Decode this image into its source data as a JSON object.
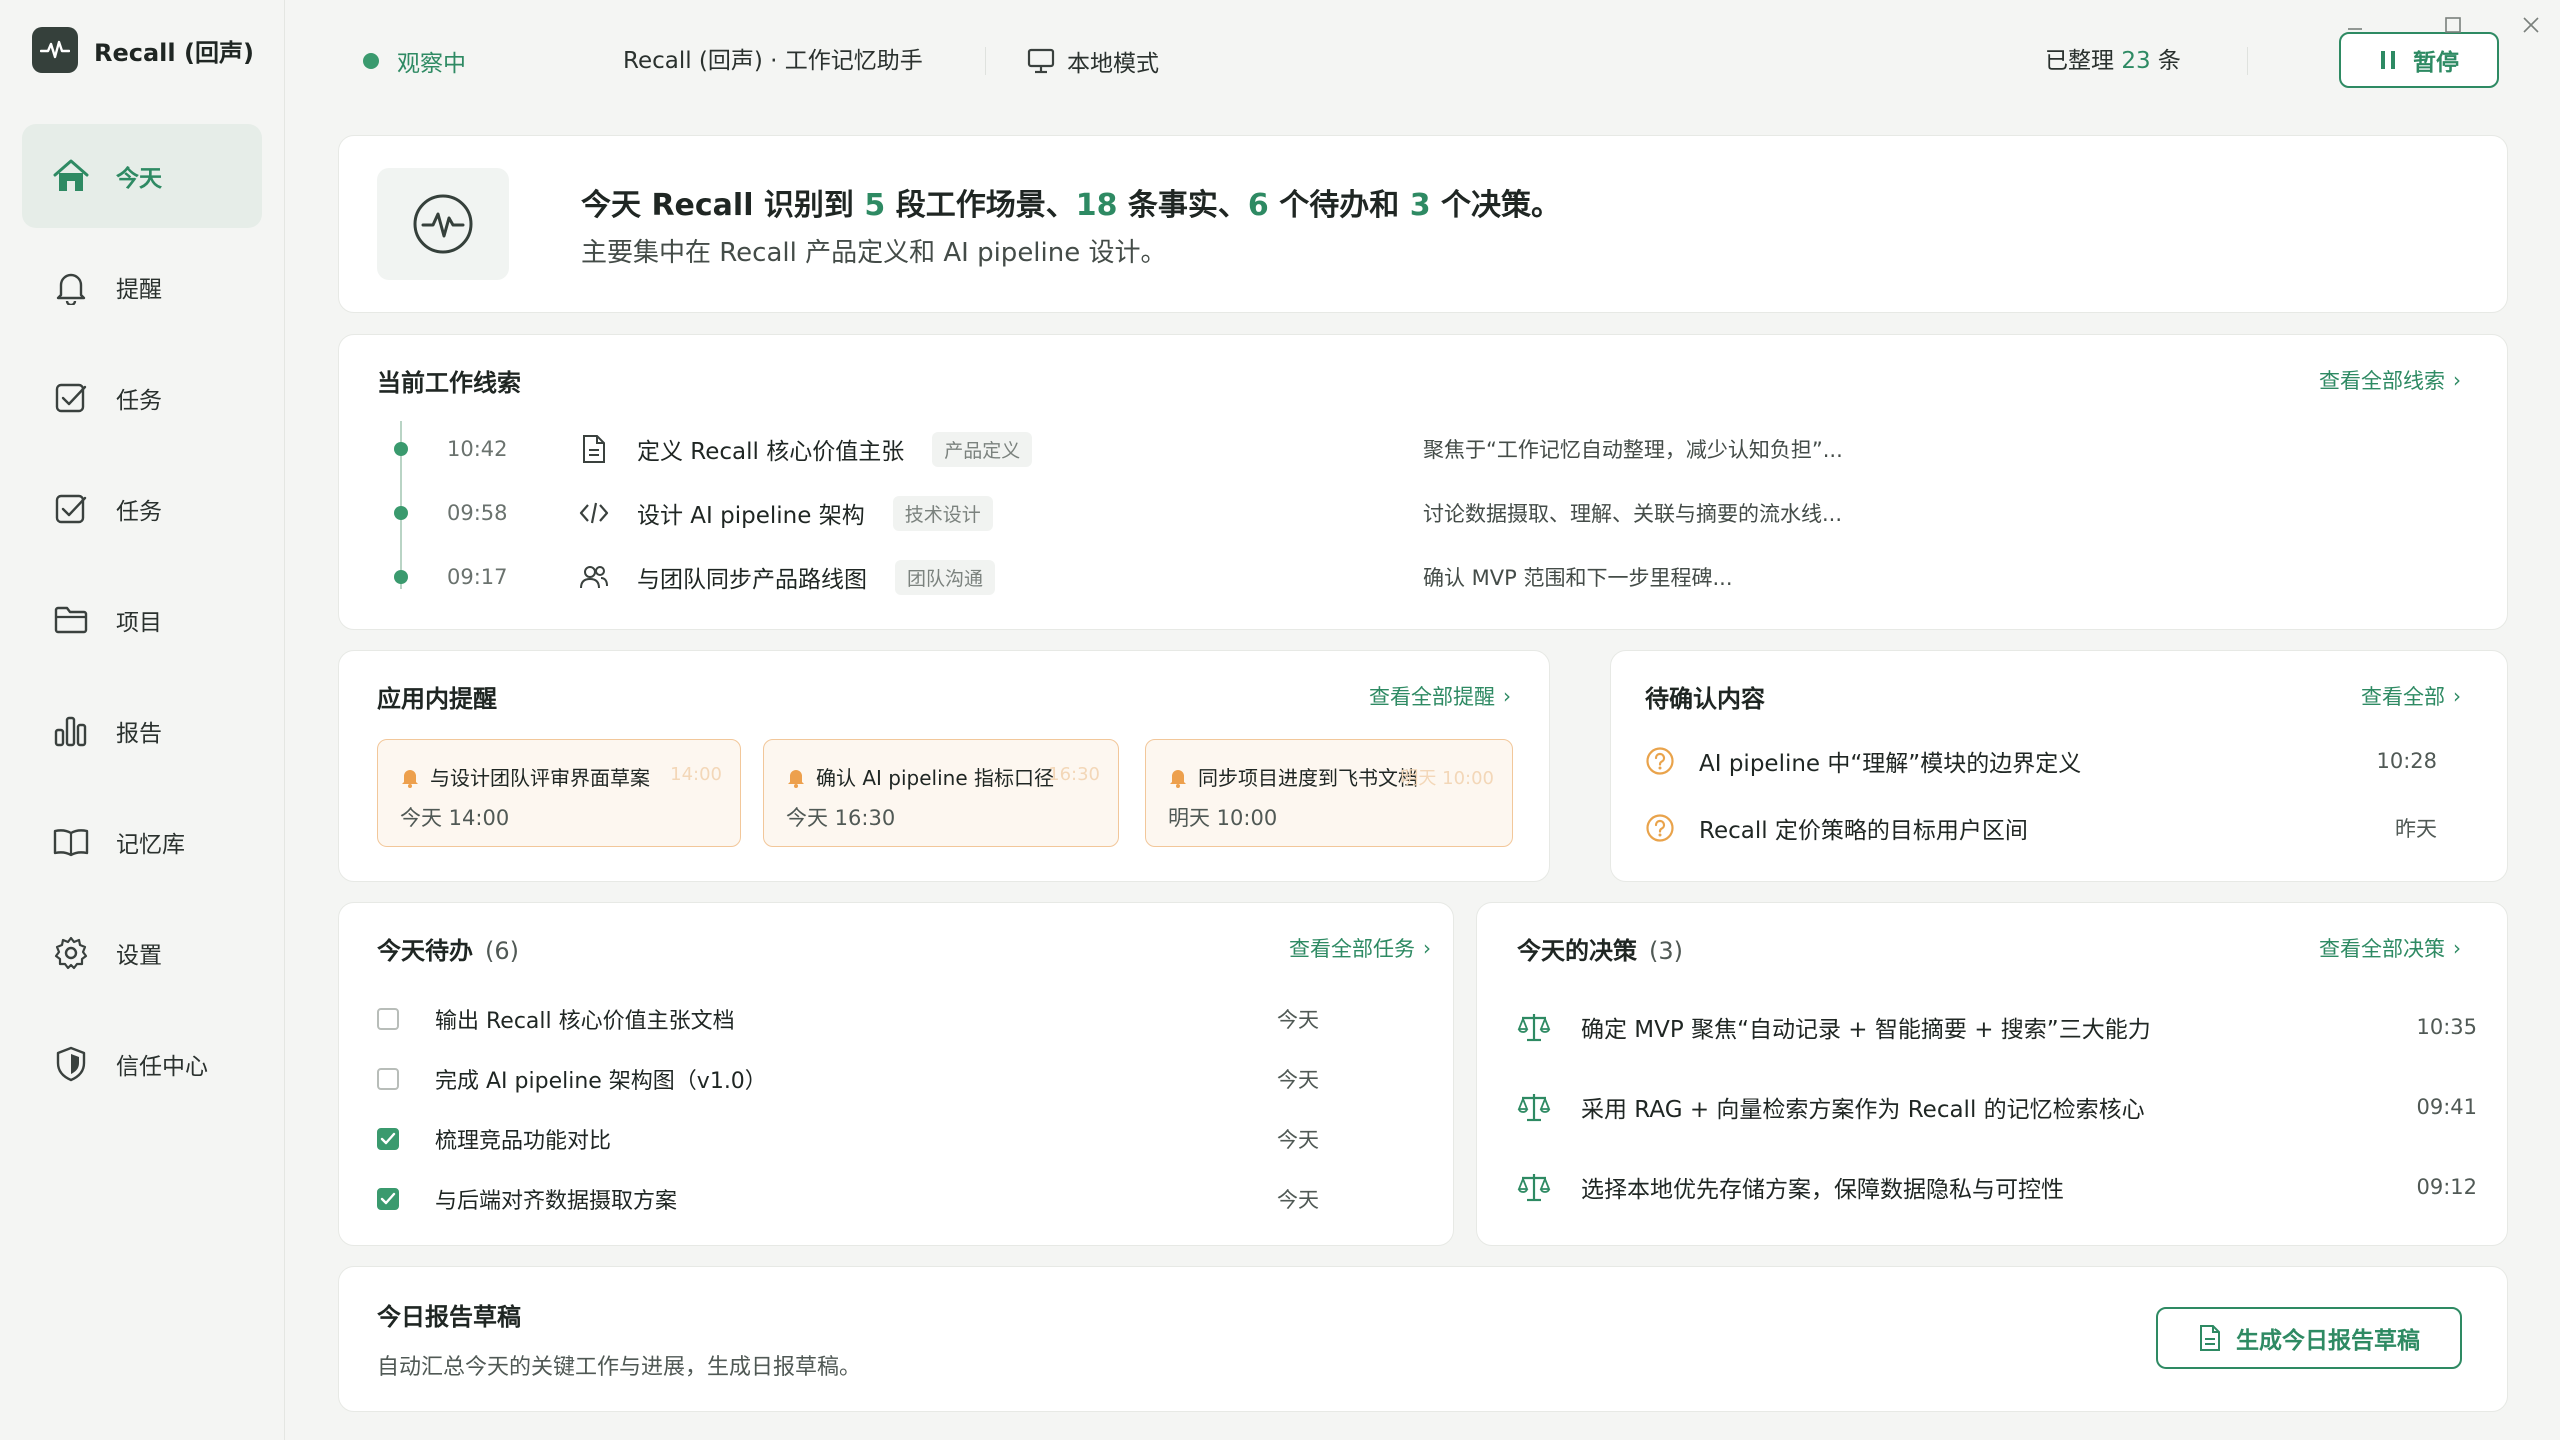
{
  "app": {
    "name": "Recall (回声)"
  },
  "sidebar": {
    "items": [
      {
        "label": "今天",
        "icon": "home-icon",
        "active": true
      },
      {
        "label": "提醒",
        "icon": "bell-icon"
      },
      {
        "label": "任务",
        "icon": "checkbox-icon"
      },
      {
        "label": "任务",
        "icon": "checkbox-icon"
      },
      {
        "label": "项目",
        "icon": "folder-icon"
      },
      {
        "label": "报告",
        "icon": "bar-chart-icon"
      },
      {
        "label": "记忆库",
        "icon": "book-icon"
      },
      {
        "label": "设置",
        "icon": "gear-icon"
      },
      {
        "label": "信任中心",
        "icon": "shield-icon"
      }
    ]
  },
  "topbar": {
    "status": "观察中",
    "title": "Recall (回声) · 工作记忆助手",
    "mode": "本地模式",
    "processed_prefix": "已整理",
    "processed_count": "23",
    "processed_suffix": "条",
    "pause_label": "暂停"
  },
  "summary": {
    "p1": "今天 Recall 识别到",
    "n1": "5",
    "p2": "段工作场景、",
    "n2": "18",
    "p3": "条事实、",
    "n3": "6",
    "p4": "个待办和",
    "n4": "3",
    "p5": "个决策。",
    "sub": "主要集中在 Recall 产品定义和 AI pipeline 设计。"
  },
  "threads": {
    "title": "当前工作线索",
    "more": "查看全部线索",
    "items": [
      {
        "time": "10:42",
        "icon": "document-icon",
        "title": "定义 Recall 核心价值主张",
        "tag": "产品定义",
        "desc": "聚焦于“工作记忆自动整理，减少认知负担”..."
      },
      {
        "time": "09:58",
        "icon": "code-icon",
        "title": "设计 AI pipeline 架构",
        "tag": "技术设计",
        "desc": "讨论数据摄取、理解、关联与摘要的流水线..."
      },
      {
        "time": "09:17",
        "icon": "users-icon",
        "title": "与团队同步产品路线图",
        "tag": "团队沟通",
        "desc": "确认 MVP 范围和下一步里程碑..."
      }
    ]
  },
  "reminders": {
    "title": "应用内提醒",
    "more": "查看全部提醒",
    "items": [
      {
        "title": "与设计团队评审界面草案",
        "ghost": "14:00",
        "time": "今天 14:00"
      },
      {
        "title": "确认 AI pipeline 指标口径",
        "ghost": "16:30",
        "time": "今天 16:30"
      },
      {
        "title": "同步项目进度到飞书文档",
        "ghost": "明天 10:00",
        "time": "明天 10:00"
      }
    ]
  },
  "pending": {
    "title": "待确认内容",
    "more": "查看全部",
    "items": [
      {
        "text": "AI pipeline 中“理解”模块的边界定义",
        "time": "10:28"
      },
      {
        "text": "Recall 定价策略的目标用户区间",
        "time": "昨天"
      }
    ]
  },
  "todos": {
    "title": "今天待办",
    "count": "(6)",
    "more": "查看全部任务",
    "items": [
      {
        "text": "输出 Recall 核心价值主张文档",
        "when": "今天",
        "done": false
      },
      {
        "text": "完成 AI pipeline 架构图（v1.0）",
        "when": "今天",
        "done": false
      },
      {
        "text": "梳理竞品功能对比",
        "when": "今天",
        "done": true
      },
      {
        "text": "与后端对齐数据摄取方案",
        "when": "今天",
        "done": true
      }
    ]
  },
  "decisions": {
    "title": "今天的决策",
    "count": "(3)",
    "more": "查看全部决策",
    "items": [
      {
        "text": "确定 MVP 聚焦“自动记录 + 智能摘要 + 搜索”三大能力",
        "time": "10:35"
      },
      {
        "text": "采用 RAG + 向量检索方案作为 Recall 的记忆检索核心",
        "time": "09:41"
      },
      {
        "text": "选择本地优先存储方案，保障数据隐私与可控性",
        "time": "09:12"
      }
    ]
  },
  "report": {
    "title": "今日报告草稿",
    "desc": "自动汇总今天的关键工作与进展，生成日报草稿。",
    "button": "生成今日报告草稿"
  },
  "colors": {
    "accent": "#2e8a63",
    "reminder_bg": "#fdf7f0",
    "reminder_border": "#f2c79a",
    "pending_icon": "#e9a34b"
  }
}
